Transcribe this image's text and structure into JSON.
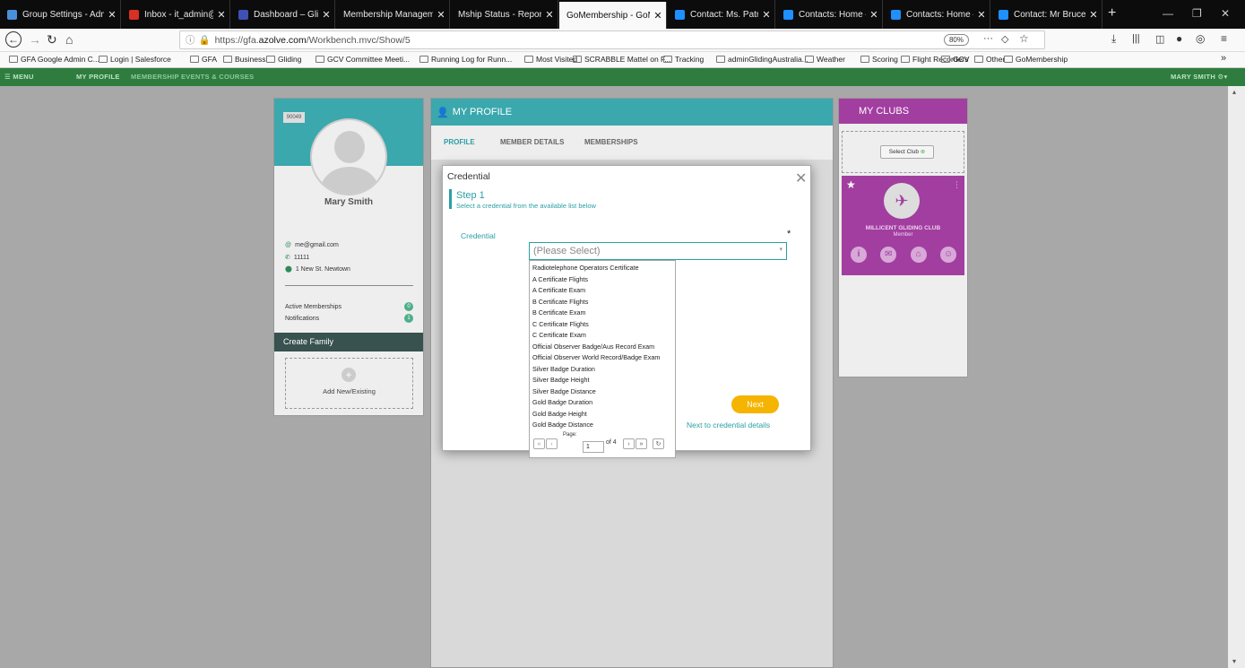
{
  "tabs": [
    {
      "label": "Group Settings - Adm",
      "color": "#4a90d9"
    },
    {
      "label": "Inbox - it_admin@gl",
      "color": "#d93025"
    },
    {
      "label": "Dashboard – Gliding",
      "color": "#3f51b5"
    },
    {
      "label": "Membership Manageme",
      "color": ""
    },
    {
      "label": "Mship Status - Report M",
      "color": ""
    },
    {
      "label": "GoMembership - GoMem",
      "color": ""
    },
    {
      "label": "Contact: Ms. Patricia",
      "color": "#1e90ff"
    },
    {
      "label": "Contacts: Home – Sal",
      "color": "#1e90ff"
    },
    {
      "label": "Contacts: Home – Sa",
      "color": "#1e90ff"
    },
    {
      "label": "Contact: Mr Bruce Ko",
      "color": "#1e90ff"
    }
  ],
  "nav": {
    "url_prefix": "https://gfa.",
    "url_domain": "azolve.com",
    "url_path": "/Workbench.mvc/Show/5",
    "zoom": "80%"
  },
  "bookmarks": [
    "GFA Google Admin C...",
    "Login | Salesforce",
    "GFA",
    "Business",
    "Gliding",
    "GCV Committee Meeti...",
    "Running Log for Runn...",
    "Most Visited",
    "SCRABBLE Mattel on F...",
    "Tracking",
    "adminGlidingAustralia...",
    "Weather",
    "Scoring",
    "Flight Recorders",
    "GCV",
    "Other",
    "GoMembership"
  ],
  "app": {
    "menu": "MENU",
    "my_profile": "MY PROFILE",
    "membership": "MEMBERSHIP",
    "events": "EVENTS & COURSES",
    "user": "MARY SMITH"
  },
  "profile": {
    "id": "90049",
    "name": "Mary Smith",
    "email": "me@gmail.com",
    "phone": "11111",
    "address": "1 New St. Newtown",
    "active_label": "Active Memberships",
    "active_count": "0",
    "notif_label": "Notifications",
    "notif_count": "1",
    "create_family": "Create Family",
    "add_new": "Add New/Existing"
  },
  "main": {
    "title": "MY PROFILE",
    "tabs": [
      "PROFILE",
      "MEMBER DETAILS",
      "MEMBERSHIPS"
    ]
  },
  "clubs": {
    "title": "MY CLUBS",
    "select": "Select Club",
    "club_name": "MILLICENT GLIDING CLUB",
    "role": "Member"
  },
  "modal": {
    "title": "Credential",
    "step": "Step 1",
    "step_desc": "Select a credential from the available list below",
    "field_label": "Credential",
    "required": "*",
    "placeholder": "(Please Select)",
    "options": [
      "Radiotelephone Operators Certificate",
      "A Certificate Flights",
      "A Certificate Exam",
      "B Certificate Flights",
      "B Certificate Exam",
      "C Certificate Flights",
      "C Certificate Exam",
      "Official Observer Badge/Aus Record Exam",
      "Official Observer World Record/Badge Exam",
      "Silver Badge Duration",
      "Silver Badge Height",
      "Silver Badge Distance",
      "Gold Badge Duration",
      "Gold Badge Height",
      "Gold Badge Distance"
    ],
    "page_label": "Page:",
    "page": "1",
    "of_pages": "of 4",
    "next": "Next",
    "next_hint": "Next to credential details"
  }
}
